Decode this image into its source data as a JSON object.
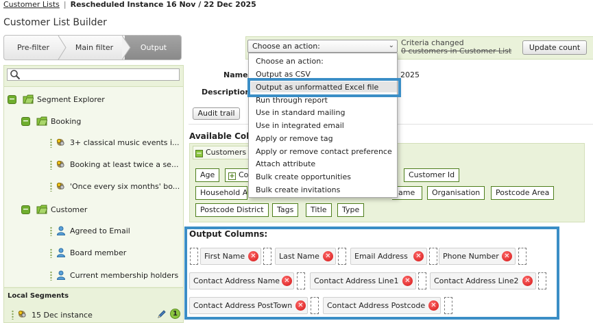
{
  "breadcrumb": {
    "link": "Customer Lists",
    "separator": "|",
    "current": "Rescheduled Instance 16 Nov / 22 Dec 2025"
  },
  "page_title": "Customer List Builder",
  "wizard": {
    "steps": [
      "Pre-filter",
      "Main filter",
      "Output"
    ],
    "active": "Output"
  },
  "action_bar": {
    "select_value": "Choose an action:",
    "criteria_line1": "Criteria changed",
    "criteria_line2": "0 customers in Customer List",
    "update_button": "Update count"
  },
  "action_menu": {
    "items": [
      "Choose an action:",
      "Output as CSV",
      "Output as unformatted Excel file",
      "Run through report",
      "Use in standard mailing",
      "Use in integrated email",
      "Apply or remove tag",
      "Apply or remove contact preference",
      "Attach attribute",
      "Bulk create opportunities",
      "Bulk create invitations"
    ],
    "highlighted": "Output as unformatted Excel file"
  },
  "sidebar": {
    "search_placeholder": "",
    "tree": {
      "root": "Segment Explorer",
      "groups": [
        {
          "label": "Booking",
          "items": [
            "3+ classical music events i...",
            "Booking at least twice a se...",
            "'Once every six months' bo..."
          ]
        },
        {
          "label": "Customer",
          "items": [
            "Agreed to Email",
            "Board member",
            "Current membership holders"
          ]
        }
      ]
    },
    "local_segments_header": "Local Segments",
    "local_segment": {
      "label": "15 Dec instance",
      "count": "1"
    }
  },
  "details": {
    "name_label": "Name",
    "name_value_tail": "2025",
    "description_label": "Description",
    "audit_button": "Audit trail"
  },
  "available_columns": {
    "title": "Available Col",
    "group_label": "Customers",
    "tags_row1": [
      "Age",
      "Co",
      "Customer Id"
    ],
    "tags_row2": [
      "Household A",
      "ame",
      "Organisation",
      "Postcode Area"
    ],
    "tags_row3": [
      "Postcode District",
      "Tags",
      "Title",
      "Type"
    ]
  },
  "output_columns": {
    "title": "Output Columns:",
    "columns": [
      "First Name",
      "Last Name",
      "Email Address",
      "Phone Number",
      "Contact Address Name",
      "Contact Address Line1",
      "Contact Address Line2",
      "Contact Address PostTown",
      "Contact Address Postcode"
    ]
  },
  "colors": {
    "panel_green": "#eaf2da",
    "tag_border": "#4c7d1a",
    "highlight_blue": "#3b8ec6",
    "remove_red": "#d31414"
  }
}
